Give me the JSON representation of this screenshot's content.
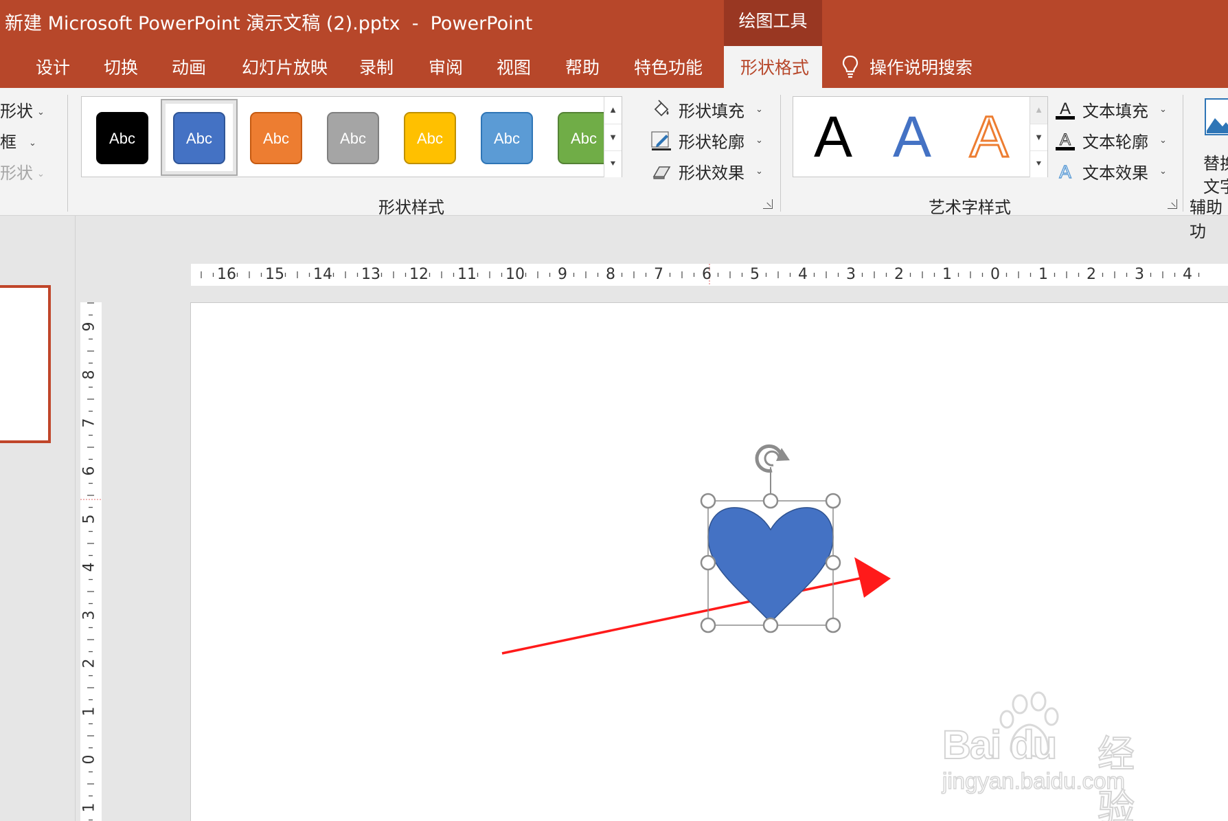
{
  "window": {
    "title": "新建 Microsoft PowerPoint 演示文稿 (2).pptx  -  PowerPoint",
    "context_tab": "绘图工具"
  },
  "tabs": [
    "设计",
    "切换",
    "动画",
    "幻灯片放映",
    "录制",
    "审阅",
    "视图",
    "帮助",
    "特色功能",
    "形状格式"
  ],
  "active_tab": "形状格式",
  "search_label": "操作说明搜索",
  "ribbon": {
    "left_group": {
      "items": [
        "形状",
        "框",
        "形状"
      ]
    },
    "shape_styles": {
      "label": "形状样式",
      "swatch_text": "Abc",
      "swatches": [
        {
          "color": "#000000",
          "border": "#000000",
          "selected": false
        },
        {
          "color": "#4472c4",
          "border": "#2f5597",
          "selected": true
        },
        {
          "color": "#ed7d31",
          "border": "#c55a11",
          "selected": false
        },
        {
          "color": "#a5a5a5",
          "border": "#7f7f7f",
          "selected": false
        },
        {
          "color": "#ffc000",
          "border": "#bf9000",
          "selected": false
        },
        {
          "color": "#5b9bd5",
          "border": "#2e75b6",
          "selected": false
        },
        {
          "color": "#70ad47",
          "border": "#548235",
          "selected": false
        }
      ],
      "menu": [
        "形状填充",
        "形状轮廓",
        "形状效果"
      ]
    },
    "wordart_styles": {
      "label": "艺术字样式",
      "letter": "A",
      "menu": [
        "文本填充",
        "文本轮廓",
        "文本效果"
      ]
    },
    "accessibility": {
      "label": "辅助功",
      "button_lines": [
        "替换",
        "文字"
      ]
    }
  },
  "ruler": {
    "horizontal": [
      "16",
      "15",
      "14",
      "13",
      "12",
      "11",
      "10",
      "9",
      "8",
      "7",
      "6",
      "5",
      "4",
      "3",
      "2",
      "1",
      "0",
      "1",
      "2",
      "3",
      "4"
    ],
    "vertical": [
      "9",
      "8",
      "7",
      "6",
      "5",
      "4",
      "3",
      "2",
      "1",
      "0",
      "1"
    ]
  },
  "slide": {
    "shape": {
      "type": "heart",
      "fill": "#4472c4",
      "stroke": "#2f528f",
      "selected": true
    },
    "annotation_arrow": {
      "color": "#ff0000"
    }
  },
  "watermark": {
    "brand": "Bai du",
    "cn": "经验",
    "url": "jingyan.baidu.com"
  },
  "colors": {
    "accent": "#b7472a",
    "accent_dark": "#993722"
  }
}
